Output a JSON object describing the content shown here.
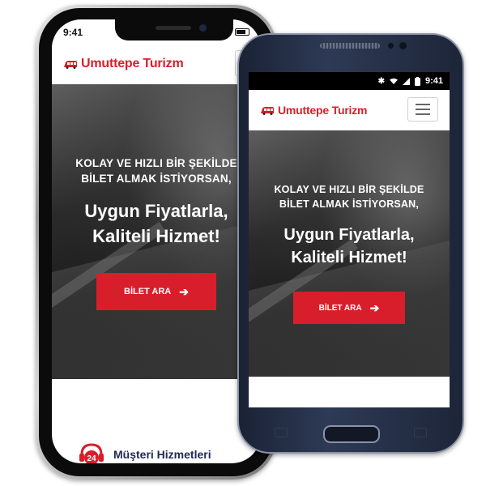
{
  "brand": {
    "name": "Umuttepe Turizm",
    "color": "#d81e2a"
  },
  "iphone": {
    "status": {
      "time": "9:41"
    }
  },
  "samsung": {
    "status": {
      "time": "9:41"
    }
  },
  "hero": {
    "tagline_line1": "KOLAY VE HIZLI BİR ŞEKİLDE",
    "tagline_line2": "BİLET ALMAK İSTİYORSAN,",
    "headline_line1": "Uygun Fiyatlarla,",
    "headline_line2": "Kaliteli Hizmet!",
    "cta_label": "BİLET ARA",
    "cta_icon": "arrow-right-icon",
    "cta_color": "#d81e2a"
  },
  "support": {
    "label": "Müşteri Hizmetleri",
    "icon": "headset-24-icon",
    "badge": "24"
  }
}
